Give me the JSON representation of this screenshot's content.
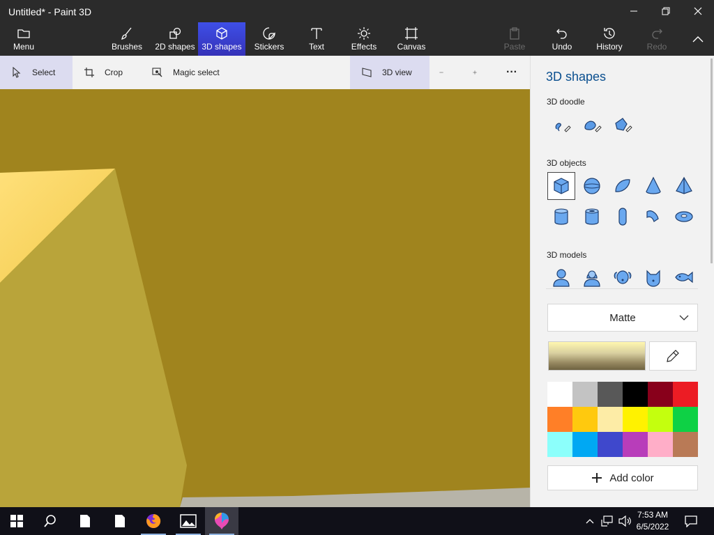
{
  "window": {
    "title": "Untitled* - Paint 3D"
  },
  "ribbon": {
    "menu": "Menu",
    "tools": [
      {
        "label": "Brushes"
      },
      {
        "label": "2D shapes"
      },
      {
        "label": "3D shapes",
        "active": true
      },
      {
        "label": "Stickers"
      },
      {
        "label": "Text"
      },
      {
        "label": "Effects"
      },
      {
        "label": "Canvas"
      }
    ],
    "paste": "Paste",
    "undo": "Undo",
    "history": "History",
    "redo": "Redo"
  },
  "subbar": {
    "select": "Select",
    "crop": "Crop",
    "magic_select": "Magic select",
    "view3d": "3D view",
    "more": "···"
  },
  "panel": {
    "title": "3D shapes",
    "doodle_heading": "3D doodle",
    "objects_heading": "3D objects",
    "models_heading": "3D models",
    "material": "Matte",
    "add_color": "Add color",
    "palette": [
      "#ffffff",
      "#c3c3c3",
      "#585858",
      "#000000",
      "#88001b",
      "#ec1c24",
      "#ff7f27",
      "#ffc90e",
      "#fdeca6",
      "#fff200",
      "#c4ff0e",
      "#0ed145",
      "#8cfffb",
      "#00a8f3",
      "#3f48cc",
      "#b83dba",
      "#ffaec8",
      "#b97a56"
    ]
  },
  "taskbar": {
    "time": "7:53 AM",
    "date": "6/5/2022"
  },
  "colors": {
    "accent": "#3e4fe8",
    "canvas": "#a0841e",
    "panel_title": "#0a4f8f"
  }
}
